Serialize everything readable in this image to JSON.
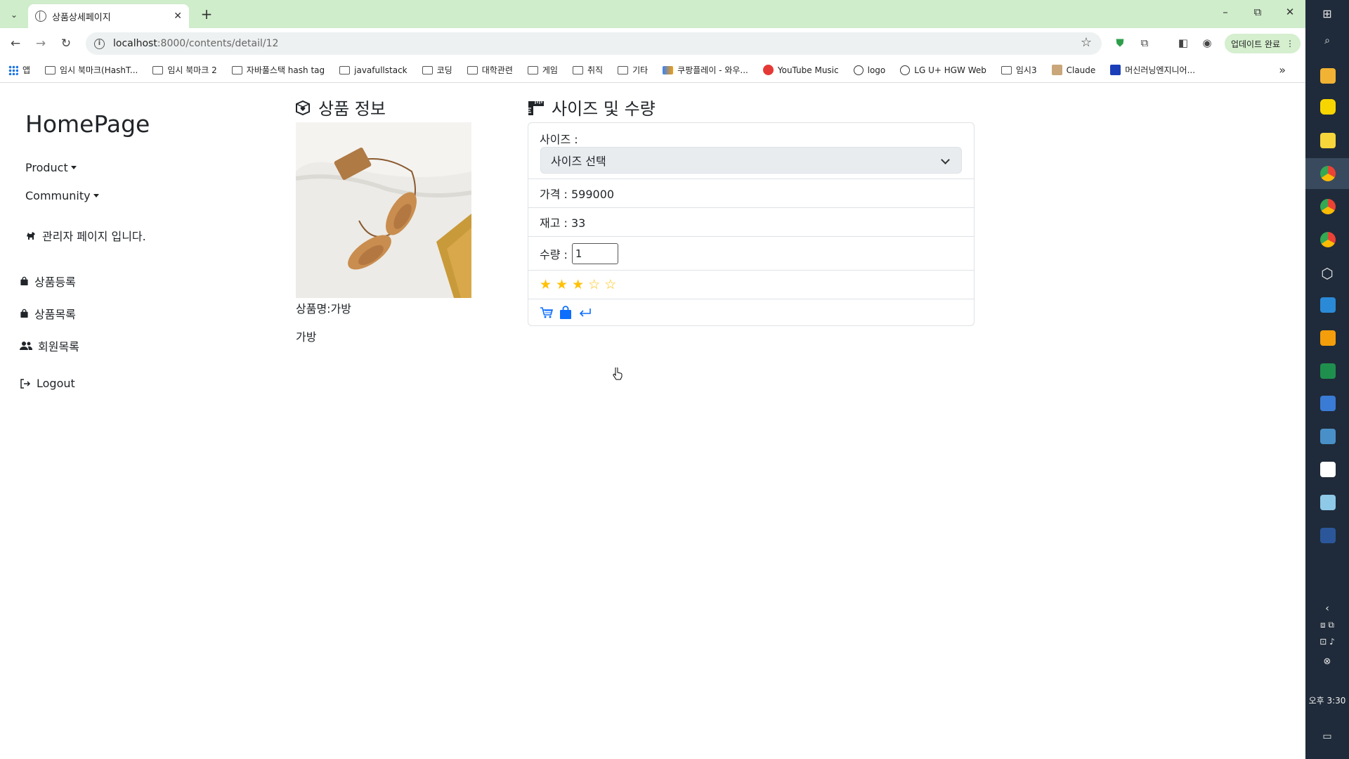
{
  "browser": {
    "tab_title": "상품상세페이지",
    "url_host": "localhost",
    "url_path": ":8000/contents/detail/12",
    "update_button": "업데이트 완료",
    "bookmarks": [
      {
        "label": "앱",
        "icon": "apps-grid-icon"
      },
      {
        "label": "임시 북마크(HashT...",
        "icon": "folder-icon"
      },
      {
        "label": "임시 북마크 2",
        "icon": "folder-icon"
      },
      {
        "label": "자바풀스택 hash tag",
        "icon": "folder-icon"
      },
      {
        "label": "javafullstack",
        "icon": "folder-icon"
      },
      {
        "label": "코딩",
        "icon": "folder-icon"
      },
      {
        "label": "대학관련",
        "icon": "folder-icon"
      },
      {
        "label": "게임",
        "icon": "folder-icon"
      },
      {
        "label": "취직",
        "icon": "folder-icon"
      },
      {
        "label": "기타",
        "icon": "folder-icon"
      },
      {
        "label": "쿠팡플레이 - 와우...",
        "icon": "coupang-icon"
      },
      {
        "label": "YouTube Music",
        "icon": "youtube-music-icon"
      },
      {
        "label": "logo",
        "icon": "globe-icon"
      },
      {
        "label": "LG U+ HGW Web",
        "icon": "globe-icon"
      },
      {
        "label": "임시3",
        "icon": "folder-icon"
      },
      {
        "label": "Claude",
        "icon": "claude-icon"
      },
      {
        "label": "머신러닝엔지니어...",
        "icon": "j-icon"
      }
    ]
  },
  "sidebar": {
    "brand": "HomePage",
    "product_label": "Product",
    "community_label": "Community",
    "admin_note": "관리자 페이지 입니다.",
    "menu": [
      {
        "label": "상품등록",
        "icon": "shopping-bag-icon"
      },
      {
        "label": "상품목록",
        "icon": "shopping-bag-icon"
      },
      {
        "label": "회원목록",
        "icon": "users-icon"
      },
      {
        "label": "Logout",
        "icon": "logout-icon"
      }
    ]
  },
  "product": {
    "section_title": "상품 정보",
    "name_line": "상품명:가방",
    "description": "가방"
  },
  "options": {
    "section_title": "사이즈 및 수량",
    "size_label": "사이즈 :",
    "size_selected": "사이즈 선택",
    "price_line": "가격 : 599000",
    "stock_line": "재고 : 33",
    "qty_label": "수량 :",
    "qty_value": "1",
    "rating": 3,
    "rating_max": 5
  },
  "taskbar": {
    "clock": "오후 3:30"
  },
  "colors": {
    "tab_strip": "#cfeccb",
    "accent_blue": "#0d6efd",
    "star": "#ffc107",
    "taskbar": "#1f2b3a"
  }
}
